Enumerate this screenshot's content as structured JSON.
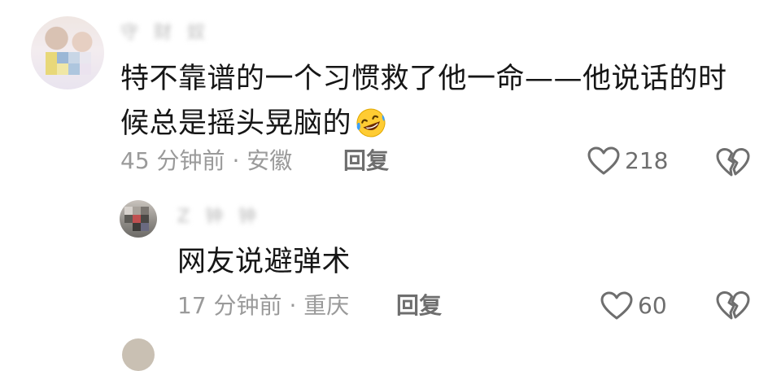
{
  "comments": [
    {
      "username": "守 财 奴",
      "text_line1": "特不靠谱的一个习惯救了他一命——他说话的时",
      "text_line2": "候总是摇头晃脑的",
      "emoji": "rofl-emoji",
      "time": "45 分钟前",
      "location": "安徽",
      "separator": "·",
      "reply_label": "回复",
      "likes": "218"
    },
    {
      "username": "Z 钟 钟",
      "text": "网友说避弹术",
      "time": "17 分钟前",
      "location": "重庆",
      "separator": "·",
      "reply_label": "回复",
      "likes": "60"
    }
  ],
  "colors": {
    "text": "#161616",
    "meta": "#9a9a9a",
    "action": "#6e6e6e"
  },
  "icons": {
    "like": "heart-outline-icon",
    "dislike": "broken-heart-icon"
  }
}
